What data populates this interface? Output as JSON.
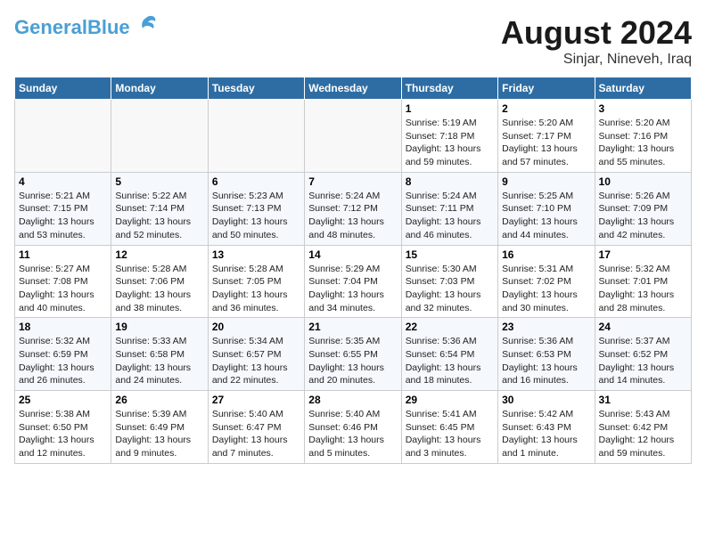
{
  "header": {
    "logo_line1": "General",
    "logo_line2": "Blue",
    "month_title": "August 2024",
    "location": "Sinjar, Nineveh, Iraq"
  },
  "weekdays": [
    "Sunday",
    "Monday",
    "Tuesday",
    "Wednesday",
    "Thursday",
    "Friday",
    "Saturday"
  ],
  "weeks": [
    [
      {
        "day": "",
        "info": ""
      },
      {
        "day": "",
        "info": ""
      },
      {
        "day": "",
        "info": ""
      },
      {
        "day": "",
        "info": ""
      },
      {
        "day": "1",
        "info": "Sunrise: 5:19 AM\nSunset: 7:18 PM\nDaylight: 13 hours\nand 59 minutes."
      },
      {
        "day": "2",
        "info": "Sunrise: 5:20 AM\nSunset: 7:17 PM\nDaylight: 13 hours\nand 57 minutes."
      },
      {
        "day": "3",
        "info": "Sunrise: 5:20 AM\nSunset: 7:16 PM\nDaylight: 13 hours\nand 55 minutes."
      }
    ],
    [
      {
        "day": "4",
        "info": "Sunrise: 5:21 AM\nSunset: 7:15 PM\nDaylight: 13 hours\nand 53 minutes."
      },
      {
        "day": "5",
        "info": "Sunrise: 5:22 AM\nSunset: 7:14 PM\nDaylight: 13 hours\nand 52 minutes."
      },
      {
        "day": "6",
        "info": "Sunrise: 5:23 AM\nSunset: 7:13 PM\nDaylight: 13 hours\nand 50 minutes."
      },
      {
        "day": "7",
        "info": "Sunrise: 5:24 AM\nSunset: 7:12 PM\nDaylight: 13 hours\nand 48 minutes."
      },
      {
        "day": "8",
        "info": "Sunrise: 5:24 AM\nSunset: 7:11 PM\nDaylight: 13 hours\nand 46 minutes."
      },
      {
        "day": "9",
        "info": "Sunrise: 5:25 AM\nSunset: 7:10 PM\nDaylight: 13 hours\nand 44 minutes."
      },
      {
        "day": "10",
        "info": "Sunrise: 5:26 AM\nSunset: 7:09 PM\nDaylight: 13 hours\nand 42 minutes."
      }
    ],
    [
      {
        "day": "11",
        "info": "Sunrise: 5:27 AM\nSunset: 7:08 PM\nDaylight: 13 hours\nand 40 minutes."
      },
      {
        "day": "12",
        "info": "Sunrise: 5:28 AM\nSunset: 7:06 PM\nDaylight: 13 hours\nand 38 minutes."
      },
      {
        "day": "13",
        "info": "Sunrise: 5:28 AM\nSunset: 7:05 PM\nDaylight: 13 hours\nand 36 minutes."
      },
      {
        "day": "14",
        "info": "Sunrise: 5:29 AM\nSunset: 7:04 PM\nDaylight: 13 hours\nand 34 minutes."
      },
      {
        "day": "15",
        "info": "Sunrise: 5:30 AM\nSunset: 7:03 PM\nDaylight: 13 hours\nand 32 minutes."
      },
      {
        "day": "16",
        "info": "Sunrise: 5:31 AM\nSunset: 7:02 PM\nDaylight: 13 hours\nand 30 minutes."
      },
      {
        "day": "17",
        "info": "Sunrise: 5:32 AM\nSunset: 7:01 PM\nDaylight: 13 hours\nand 28 minutes."
      }
    ],
    [
      {
        "day": "18",
        "info": "Sunrise: 5:32 AM\nSunset: 6:59 PM\nDaylight: 13 hours\nand 26 minutes."
      },
      {
        "day": "19",
        "info": "Sunrise: 5:33 AM\nSunset: 6:58 PM\nDaylight: 13 hours\nand 24 minutes."
      },
      {
        "day": "20",
        "info": "Sunrise: 5:34 AM\nSunset: 6:57 PM\nDaylight: 13 hours\nand 22 minutes."
      },
      {
        "day": "21",
        "info": "Sunrise: 5:35 AM\nSunset: 6:55 PM\nDaylight: 13 hours\nand 20 minutes."
      },
      {
        "day": "22",
        "info": "Sunrise: 5:36 AM\nSunset: 6:54 PM\nDaylight: 13 hours\nand 18 minutes."
      },
      {
        "day": "23",
        "info": "Sunrise: 5:36 AM\nSunset: 6:53 PM\nDaylight: 13 hours\nand 16 minutes."
      },
      {
        "day": "24",
        "info": "Sunrise: 5:37 AM\nSunset: 6:52 PM\nDaylight: 13 hours\nand 14 minutes."
      }
    ],
    [
      {
        "day": "25",
        "info": "Sunrise: 5:38 AM\nSunset: 6:50 PM\nDaylight: 13 hours\nand 12 minutes."
      },
      {
        "day": "26",
        "info": "Sunrise: 5:39 AM\nSunset: 6:49 PM\nDaylight: 13 hours\nand 9 minutes."
      },
      {
        "day": "27",
        "info": "Sunrise: 5:40 AM\nSunset: 6:47 PM\nDaylight: 13 hours\nand 7 minutes."
      },
      {
        "day": "28",
        "info": "Sunrise: 5:40 AM\nSunset: 6:46 PM\nDaylight: 13 hours\nand 5 minutes."
      },
      {
        "day": "29",
        "info": "Sunrise: 5:41 AM\nSunset: 6:45 PM\nDaylight: 13 hours\nand 3 minutes."
      },
      {
        "day": "30",
        "info": "Sunrise: 5:42 AM\nSunset: 6:43 PM\nDaylight: 13 hours\nand 1 minute."
      },
      {
        "day": "31",
        "info": "Sunrise: 5:43 AM\nSunset: 6:42 PM\nDaylight: 12 hours\nand 59 minutes."
      }
    ]
  ]
}
